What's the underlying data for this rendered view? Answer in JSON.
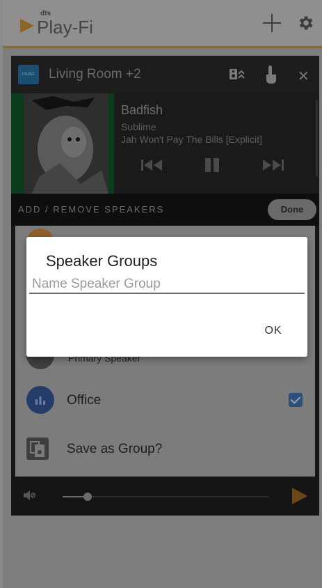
{
  "app": {
    "logo_small": "dts",
    "logo_text": "Play-Fi"
  },
  "zone": {
    "title": "Living Room +2",
    "service_icon_text": "music"
  },
  "now_playing": {
    "title": "Badfish",
    "artist": "Sublime",
    "album": "Jah Won't Pay The Bills [Explicit]"
  },
  "add_remove": {
    "label": "ADD / REMOVE SPEAKERS",
    "done_label": "Done"
  },
  "speakers": [
    {
      "name": "Primary Speaker",
      "checked": true
    },
    {
      "name": "Office",
      "checked": true
    }
  ],
  "save_group_label": "Save as Group?",
  "volume": {
    "level": 0.12
  },
  "dialog": {
    "title": "Speaker Groups",
    "input_placeholder": "Name Speaker Group",
    "input_value": "",
    "ok_label": "OK"
  },
  "colors": {
    "accent": "#f7a935",
    "checkbox": "#3b78c9",
    "office_avatar": "#3562c0"
  }
}
